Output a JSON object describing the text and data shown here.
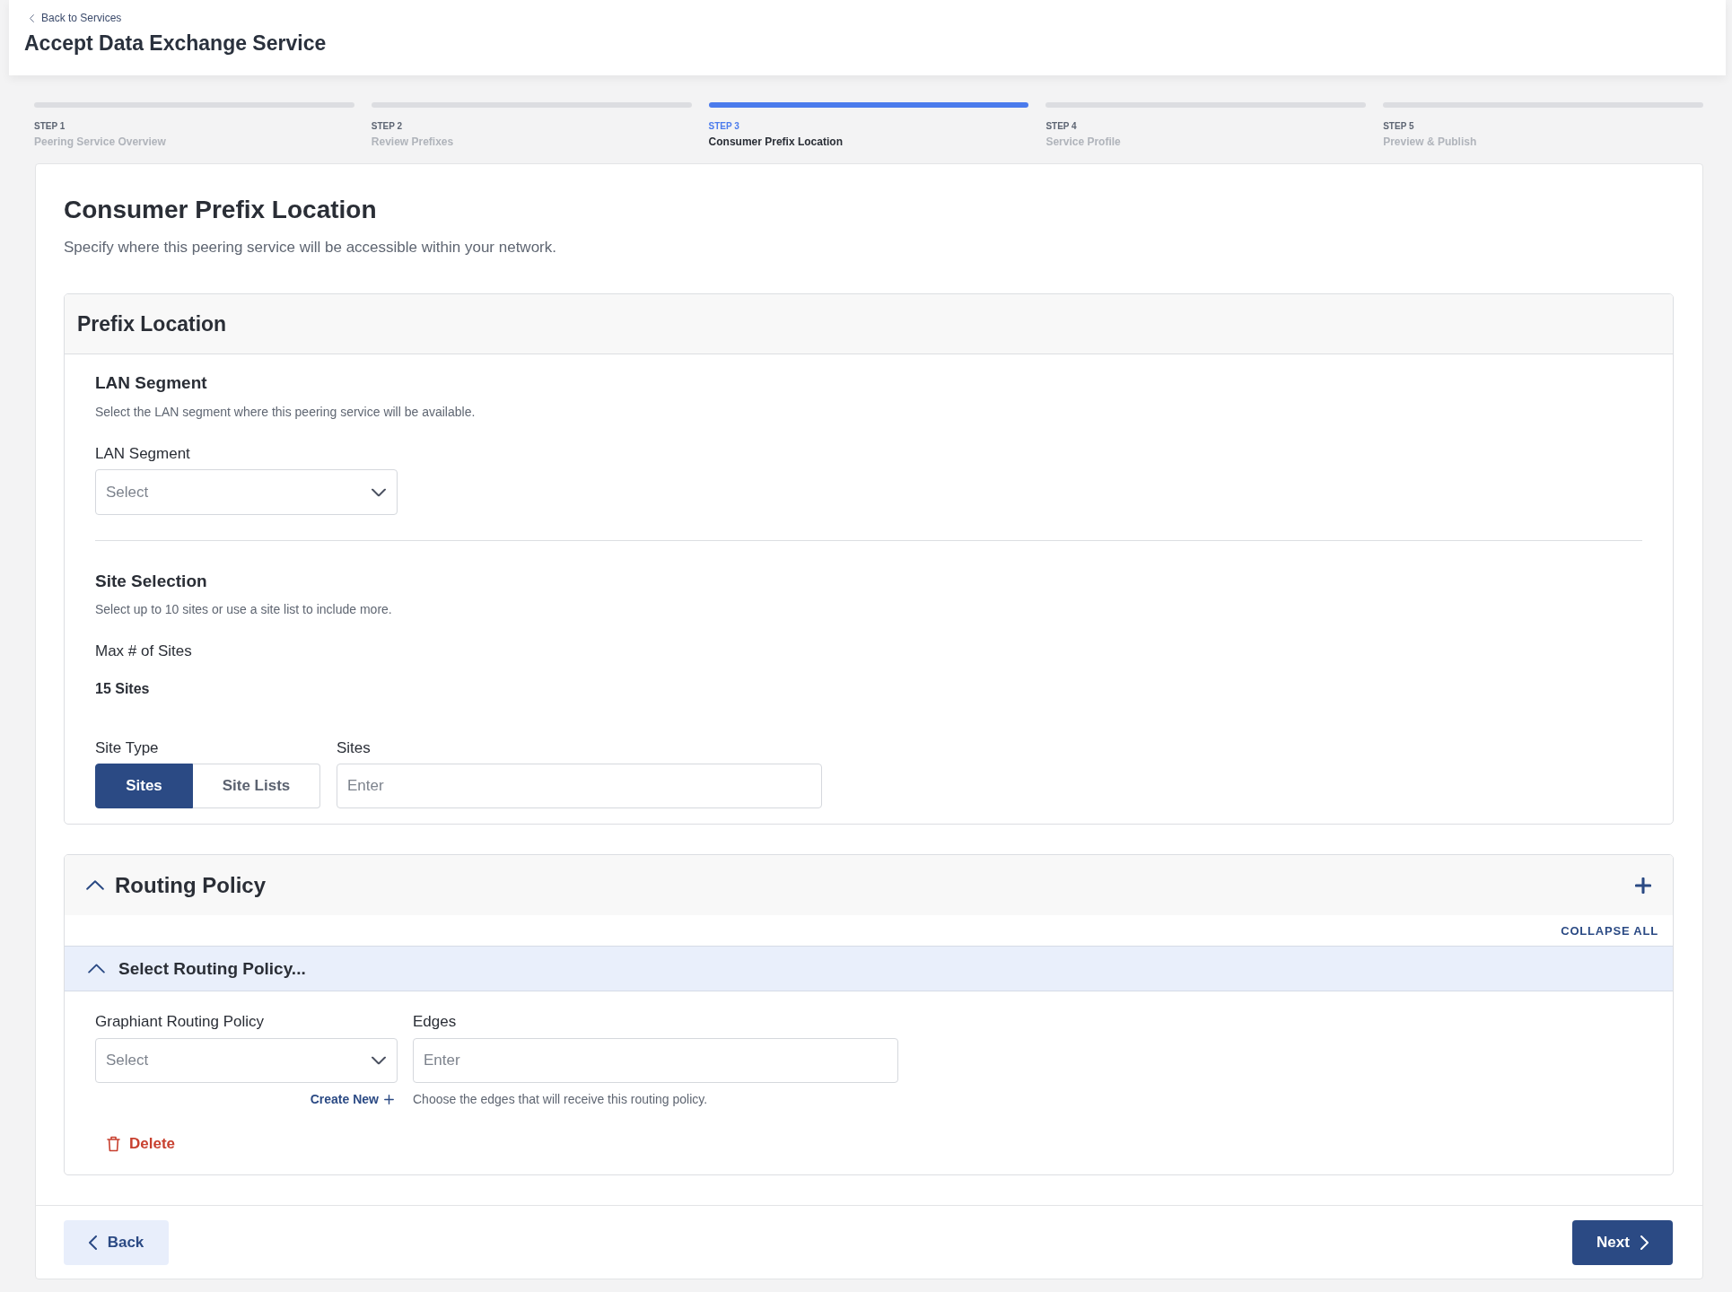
{
  "header": {
    "back_link": "Back to Services",
    "title": "Accept Data Exchange Service"
  },
  "steps": [
    {
      "number": "STEP 1",
      "name": "Peering Service Overview",
      "selected": false
    },
    {
      "number": "STEP 2",
      "name": "Review Prefixes",
      "selected": false
    },
    {
      "number": "STEP 3",
      "name": "Consumer Prefix Location",
      "selected": true
    },
    {
      "number": "STEP 4",
      "name": "Service Profile",
      "selected": false
    },
    {
      "number": "STEP 5",
      "name": "Preview & Publish",
      "selected": false
    }
  ],
  "page": {
    "title": "Consumer Prefix Location",
    "description": "Specify where this peering service will be accessible within your network."
  },
  "prefix_location": {
    "title": "Prefix Location",
    "lan_segment": {
      "heading": "LAN Segment",
      "description": "Select the LAN segment where this peering service will be available.",
      "field": {
        "label": "LAN Segment",
        "placeholder": "Select"
      }
    },
    "site_selection": {
      "heading": "Site Selection",
      "description": "Select up to 10 sites or use a site list to include more.",
      "max_label": "Max # of Sites",
      "max_value": "15 Sites",
      "site_type": {
        "label": "Site Type",
        "options": [
          {
            "label": "Sites",
            "selected": true
          },
          {
            "label": "Site Lists",
            "selected": false
          }
        ]
      },
      "sites_field": {
        "label": "Sites",
        "placeholder": "Enter"
      }
    }
  },
  "routing_policy": {
    "title": "Routing Policy",
    "expanded": true,
    "collapse_all": "COLLAPSE ALL",
    "policies": [
      {
        "title": "Select Routing Policy...",
        "expanded": true,
        "policy_field": {
          "label": "Graphiant Routing Policy",
          "placeholder": "Select"
        },
        "create_new": "Create New",
        "edges_field": {
          "label": "Edges",
          "placeholder": "Enter",
          "help": "Choose the edges that will receive this routing policy."
        },
        "delete": "Delete"
      }
    ]
  },
  "footer": {
    "back": "Back",
    "next": "Next"
  }
}
